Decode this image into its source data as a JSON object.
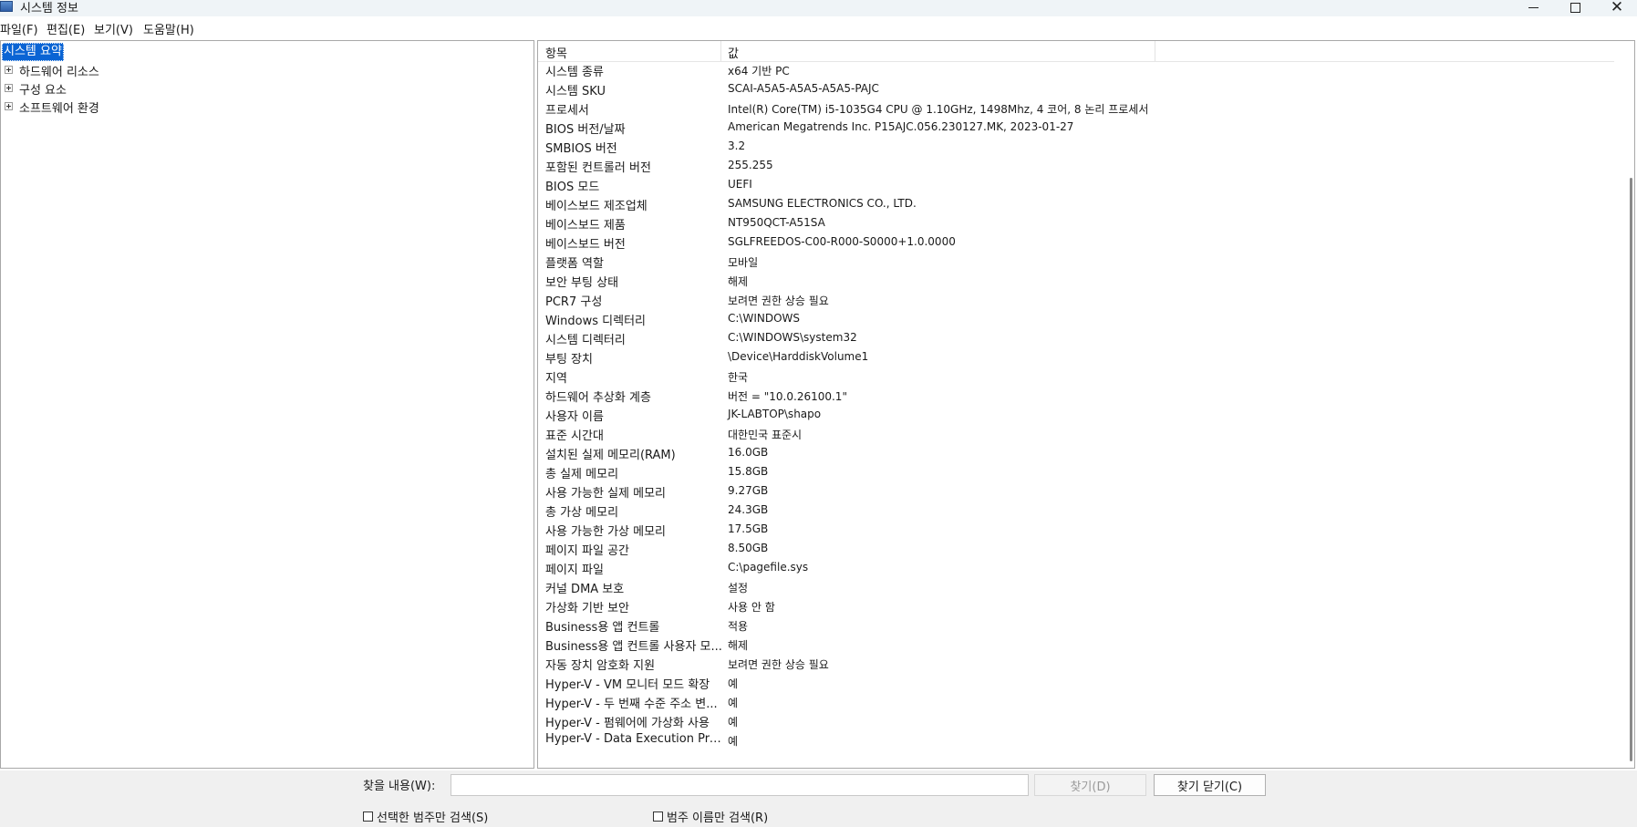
{
  "window": {
    "title": "시스템 정보",
    "controls": [
      "minimize-icon",
      "maximize-icon",
      "close-icon"
    ]
  },
  "menu": {
    "file": "파일(F)",
    "edit": "편집(E)",
    "view": "보기(V)",
    "help": "도움말(H)"
  },
  "tree": {
    "root": "시스템 요약",
    "children": [
      "하드웨어 리소스",
      "구성 요소",
      "소프트웨어 환경"
    ]
  },
  "list": {
    "headers": {
      "item": "항목",
      "value": "값"
    },
    "rows": [
      {
        "item": "시스템 종류",
        "value": "x64 기반 PC"
      },
      {
        "item": "시스템 SKU",
        "value": "SCAI-A5A5-A5A5-A5A5-PAJC"
      },
      {
        "item": "프로세서",
        "value": "Intel(R) Core(TM) i5-1035G4 CPU @ 1.10GHz, 1498Mhz, 4 코어, 8 논리 프로세서"
      },
      {
        "item": "BIOS 버전/날짜",
        "value": "American Megatrends Inc. P15AJC.056.230127.MK, 2023-01-27"
      },
      {
        "item": "SMBIOS 버전",
        "value": "3.2"
      },
      {
        "item": "포함된 컨트롤러 버전",
        "value": "255.255"
      },
      {
        "item": "BIOS 모드",
        "value": "UEFI"
      },
      {
        "item": "베이스보드 제조업체",
        "value": "SAMSUNG ELECTRONICS CO., LTD."
      },
      {
        "item": "베이스보드 제품",
        "value": "NT950QCT-A51SA"
      },
      {
        "item": "베이스보드 버전",
        "value": "SGLFREEDOS-C00-R000-S0000+1.0.0000"
      },
      {
        "item": "플랫폼 역할",
        "value": "모바일"
      },
      {
        "item": "보안 부팅 상태",
        "value": "해제"
      },
      {
        "item": "PCR7 구성",
        "value": "보려면 권한 상승 필요"
      },
      {
        "item": "Windows 디렉터리",
        "value": "C:\\WINDOWS"
      },
      {
        "item": "시스템 디렉터리",
        "value": "C:\\WINDOWS\\system32"
      },
      {
        "item": "부팅 장치",
        "value": "\\Device\\HarddiskVolume1"
      },
      {
        "item": "지역",
        "value": "한국"
      },
      {
        "item": "하드웨어 추상화 계층",
        "value": "버전 = \"10.0.26100.1\""
      },
      {
        "item": "사용자 이름",
        "value": "JK-LABTOP\\shapo"
      },
      {
        "item": "표준 시간대",
        "value": "대한민국 표준시"
      },
      {
        "item": "설치된 실제 메모리(RAM)",
        "value": "16.0GB"
      },
      {
        "item": "총 실제 메모리",
        "value": "15.8GB"
      },
      {
        "item": "사용 가능한 실제 메모리",
        "value": "9.27GB"
      },
      {
        "item": "총 가상 메모리",
        "value": "24.3GB"
      },
      {
        "item": "사용 가능한 가상 메모리",
        "value": "17.5GB"
      },
      {
        "item": "페이지 파일 공간",
        "value": "8.50GB"
      },
      {
        "item": "페이지 파일",
        "value": "C:\\pagefile.sys"
      },
      {
        "item": "커널 DMA 보호",
        "value": "설정"
      },
      {
        "item": "가상화 기반 보안",
        "value": "사용 안 함"
      },
      {
        "item": "Business용 앱 컨트롤",
        "value": "적용"
      },
      {
        "item": "Business용 앱 컨트롤 사용자 모...",
        "value": "해제"
      },
      {
        "item": "자동 장치 암호화 지원",
        "value": "보려면 권한 상승 필요"
      },
      {
        "item": "Hyper-V - VM 모니터 모드 확장",
        "value": "예"
      },
      {
        "item": "Hyper-V - 두 번째 수준 주소 변...",
        "value": "예"
      },
      {
        "item": "Hyper-V - 펌웨어에 가상화 사용",
        "value": "예"
      },
      {
        "item": "Hyper-V - Data Execution Prote...",
        "value": "예"
      }
    ]
  },
  "search": {
    "label": "찾을 내용(W):",
    "value": "",
    "find_label": "찾기(D)",
    "close_find_label": "찾기 닫기(C)",
    "selected_only_label": "선택한 범주만 검색(S)",
    "category_names_label": "범주 이름만 검색(R)"
  }
}
